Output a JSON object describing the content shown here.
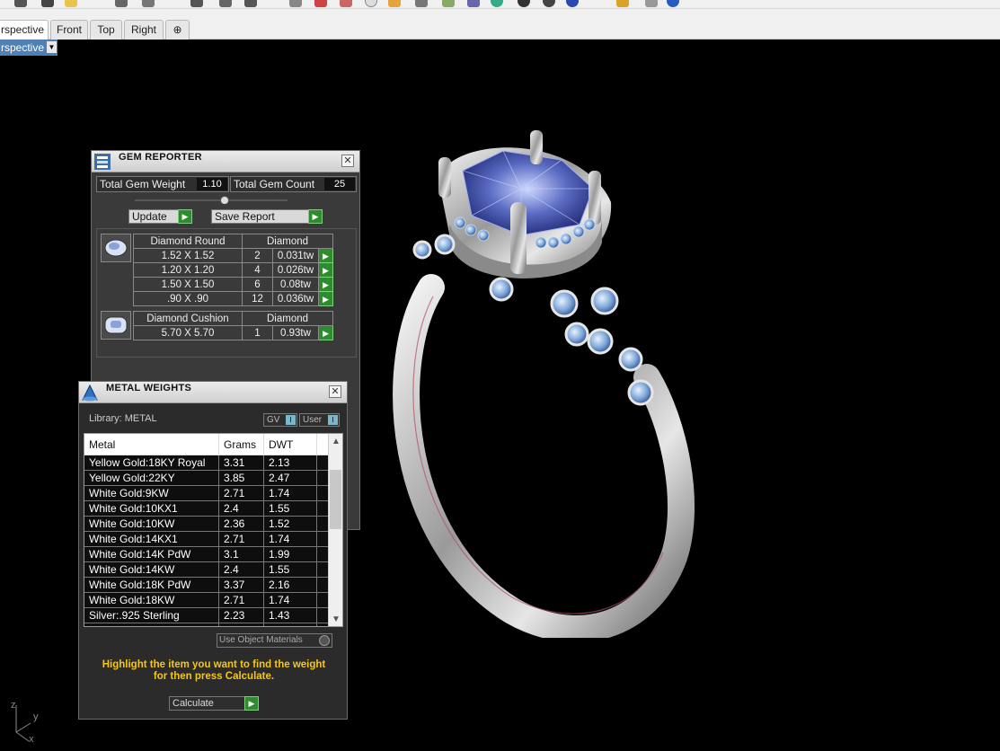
{
  "viewport_tabs": [
    "rspective",
    "Front",
    "Top",
    "Right"
  ],
  "add_tab_icon": "plus-icon",
  "view_label": "rspective",
  "axis": {
    "z": "z",
    "y": "y",
    "x": "x"
  },
  "gem_reporter": {
    "title": "GEM REPORTER",
    "total_gem_weight_label": "Total Gem Weight",
    "total_gem_weight": "1.10",
    "total_gem_count_label": "Total Gem Count",
    "total_gem_count": "25",
    "update_label": "Update",
    "save_report_label": "Save Report",
    "groups": [
      {
        "name": "Diamond Round",
        "material": "Diamond",
        "rows": [
          {
            "size": "1.52 X 1.52",
            "count": "2",
            "weight": "0.031tw"
          },
          {
            "size": "1.20 X 1.20",
            "count": "4",
            "weight": "0.026tw"
          },
          {
            "size": "1.50 X 1.50",
            "count": "6",
            "weight": "0.08tw"
          },
          {
            "size": ".90 X .90",
            "count": "12",
            "weight": "0.036tw"
          }
        ]
      },
      {
        "name": "Diamond Cushion",
        "material": "Diamond",
        "rows": [
          {
            "size": "5.70 X 5.70",
            "count": "1",
            "weight": "0.93tw"
          }
        ]
      }
    ]
  },
  "metal_weights": {
    "title": "METAL WEIGHTS",
    "library_label": "Library: METAL",
    "gv_label": "GV",
    "user_label": "User",
    "columns": [
      "Metal",
      "Grams",
      "DWT"
    ],
    "rows": [
      {
        "metal": "Yellow Gold:18KY Royal",
        "grams": "3.31",
        "dwt": "2.13"
      },
      {
        "metal": "Yellow Gold:22KY",
        "grams": "3.85",
        "dwt": "2.47"
      },
      {
        "metal": "White Gold:9KW",
        "grams": "2.71",
        "dwt": "1.74"
      },
      {
        "metal": "White Gold:10KX1",
        "grams": "2.4",
        "dwt": "1.55"
      },
      {
        "metal": "White Gold:10KW",
        "grams": "2.36",
        "dwt": "1.52"
      },
      {
        "metal": "White Gold:14KX1",
        "grams": "2.71",
        "dwt": "1.74"
      },
      {
        "metal": "White Gold:14K PdW",
        "grams": "3.1",
        "dwt": "1.99"
      },
      {
        "metal": "White Gold:14KW",
        "grams": "2.4",
        "dwt": "1.55"
      },
      {
        "metal": "White Gold:18K PdW",
        "grams": "3.37",
        "dwt": "2.16"
      },
      {
        "metal": "White Gold:18KW",
        "grams": "2.71",
        "dwt": "1.74"
      },
      {
        "metal": "Silver:.925 Sterling",
        "grams": "2.23",
        "dwt": "1.43"
      }
    ],
    "use_object_materials_label": "Use Object Materials",
    "hint_line1": "Highlight the item you want to find the weight",
    "hint_line2": "for then press Calculate.",
    "calculate_label": "Calculate"
  }
}
